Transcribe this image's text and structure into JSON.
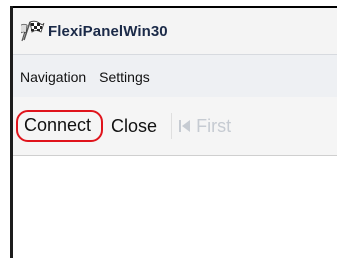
{
  "window": {
    "title": "FlexiPanelWin30",
    "icon": "checkered-flag-icon"
  },
  "menubar": {
    "items": [
      "Navigation",
      "Settings"
    ]
  },
  "toolbar": {
    "connect_label": "Connect",
    "close_label": "Close",
    "first_label": "First",
    "first_icon": "first-record-icon",
    "highlight_color": "#e0141c"
  }
}
